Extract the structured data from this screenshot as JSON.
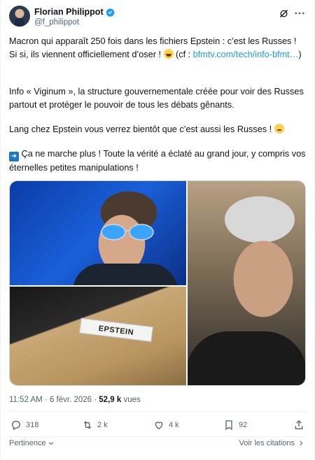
{
  "author": {
    "name": "Florian Philippot",
    "handle": "@f_philippot"
  },
  "tweet": {
    "p1_a": "Macron qui apparaît 250 fois dans les fichiers Epstein : c’est les Russes ! Si si, ils viennent officiellement d’oser ! ",
    "p1_b": " (cf : ",
    "p1_link": "bfmtv.com/tech/info-bfmt…",
    "p1_c": ")",
    "p2": "Info « Viginum », la structure gouvernementale créée pour voir des Russes partout et protéger le pouvoir de tous les débats gênants.",
    "p3": "Lang chez Epstein vous verrez bientôt que c’est aussi les Russes ! ",
    "p4": " Ça ne marche plus ! Toute la vérité a éclaté au grand jour, y compris vos éternelles petites manipulations !",
    "doc_label": "EPSTEIN"
  },
  "meta": {
    "time_date": "11:52 AM · 6 févr. 2026 · ",
    "views_count": "52,9 k",
    "views_label": " vues"
  },
  "actions": {
    "replies": "318",
    "retweets": "2 k",
    "likes": "4 k",
    "bookmarks": "92"
  },
  "footer": {
    "sort_label": "Pertinence",
    "quotes_label": "Voir les citations"
  },
  "colors": {
    "accent": "#1d9bf0",
    "text": "#0f1419",
    "muted": "#536471"
  }
}
